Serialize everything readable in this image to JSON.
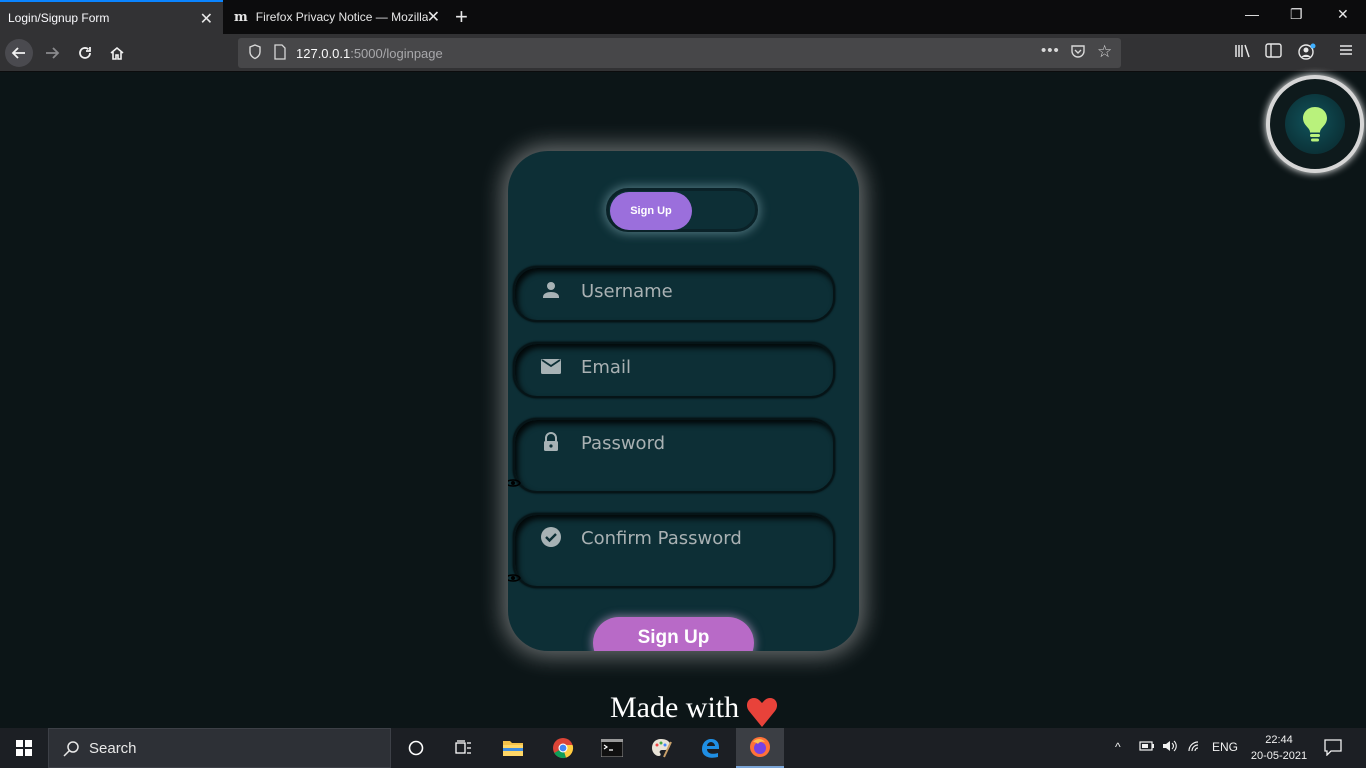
{
  "browser": {
    "tabs": [
      {
        "title": "Login/Signup Form",
        "active": true
      },
      {
        "title": "Firefox Privacy Notice — Mozilla",
        "active": false
      }
    ],
    "url_host": "127.0.0.1",
    "url_path": ":5000/loginpage"
  },
  "form": {
    "toggle_label": "Sign Up",
    "fields": {
      "username_placeholder": "Username",
      "email_placeholder": "Email",
      "password_placeholder": "Password",
      "confirm_placeholder": "Confirm Password"
    },
    "submit_label": "Sign Up"
  },
  "footer": {
    "text": "Made with"
  },
  "taskbar": {
    "search_label": "Search",
    "language": "ENG",
    "time": "22:44",
    "date": "20-05-2021"
  },
  "colors": {
    "page_bg": "#0c1517",
    "card_bg": "#0d2f36",
    "toggle_accent": "#9b6fdc",
    "button_accent": "#b86ac7",
    "bulb": "#b9f27c"
  }
}
